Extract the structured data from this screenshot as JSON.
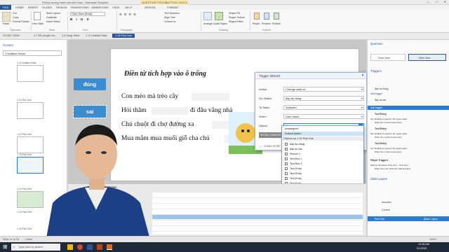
{
  "window": {
    "title": "Phòng tương xanh vào hiệu hợp - Articulate Storyline",
    "context_tab_1": "QUESTION TOOLS",
    "context_tab_2": "BUTTON TOOLS"
  },
  "ribbon_tabs": [
    "FILE",
    "HOME",
    "INSERT",
    "SLIDES",
    "DESIGN",
    "TRANSITIONS",
    "ANIMATIONS",
    "VIEW",
    "HELP"
  ],
  "context_subtabs": [
    "DESIGN",
    "FORMAT"
  ],
  "ribbon": {
    "clipboard": "Clipboard",
    "paste": "Paste",
    "cut": "Cut",
    "copy": "Copy",
    "format_painter": "Format Painter",
    "new_slide": "New Slide",
    "new_layout": "Slide Layout",
    "duplicate": "Duplicate",
    "insert_slides": "Insert Slides",
    "slide_group": "Slide",
    "font_name": "Open Sans (Body)",
    "font_group": "Font",
    "paragraph_group": "Paragraph",
    "text_direction": "Text Direction",
    "align_text": "Align Text",
    "convert": "Convert to",
    "arrange": "Arrange",
    "quick_styles": "Quick Styles",
    "shape_fill": "Shape Fill",
    "shape_outline": "Shape Outline",
    "shape_effect": "Shape Effect",
    "drawing_group": "Drawing",
    "player": "Player",
    "preview": "Preview",
    "publish": "Publish",
    "publish_group": "Publish"
  },
  "doc_tabs": [
    "STORY VIEW",
    "1.7 Hỗ chuyện nh...",
    "1.3 Vùng 'kiếm'",
    "1.11 Untitled Slide",
    "1.15 Pick One"
  ],
  "scenes": {
    "header": "Scenes",
    "scene_select": "1 Untitled Scene",
    "thumbs": [
      "1.10 Untitled Slide",
      "1.11 Pick One",
      "1.12 Pick One",
      "1.13 Pick One",
      "1.14 Pick One",
      "1.15 Pick One",
      "1.16 Pick One"
    ]
  },
  "slide": {
    "title": "Điền từ tích hợp vào ô trống",
    "word_1": "đúng",
    "word_2": "sai",
    "lines": [
      "Con mèo mà trèo cây",
      "Hỏi thăm",
      "đi đâu vắng nhà",
      "Chú chuột đi chợ đường xa",
      "Mua mắm mua muối giỗ cha chú"
    ]
  },
  "timeline": {
    "tab_timeline": "Timeline",
    "tab_states": "States",
    "tab_notes": "Notes"
  },
  "wizard": {
    "title": "Trigger Wizard",
    "fields": [
      {
        "label": "Action:",
        "value": "Change state of"
      },
      {
        "label": "On Object:",
        "value": "đáp án đúng"
      },
      {
        "label": "To State:",
        "value": "Selected"
      },
      {
        "label": "When:",
        "value": "User clicks"
      },
      {
        "label": "Object:",
        "value": "đáp án sai"
      }
    ],
    "show_conditions": "SHOW CONDITIONS",
    "learn_more": "LEARN MORE"
  },
  "dropdown": {
    "items_top": [
      "unassigned",
      "Submit button"
    ],
    "section_1": "Objects on 1.15 Pick One",
    "objects": [
      "đáp án đúng",
      "đáp án sai",
      "Picture 1",
      "Text Box 1",
      "Text Box 2",
      "Text Entry",
      "Text Entry",
      "Text Entry",
      "Text Entry"
    ],
    "section_2": "Create Navigation",
    "nav": [
      "Previous Button",
      "Swipe Previous",
      "Previous Button / Swipe Previous",
      "Next Button",
      "Swipe Next",
      "Next Button / Swipe Next"
    ]
  },
  "right": {
    "question_header": "Question",
    "form_view": "Form View",
    "slide_view": "Slide View",
    "triggers_header": "Triggers",
    "trigger_items": [
      "đáp án đúng",
      "Add trigger",
      "đáp án sai",
      "Add trigger"
    ],
    "text_entry": "Text Entry",
    "text_entry_desc": "Set TextEntry1 equal to the typed value",
    "text_entry_desc2": "When the control loses focus",
    "player_triggers": "Player Triggers",
    "player_desc": "Submit interaction 'Pick One' - 'Pick One'",
    "player_desc2": "When the user clicks the submit button",
    "slide_layers": "Slide Layers",
    "layers": [
      "Incorrect",
      "Correct",
      "Pick One"
    ],
    "base_layer": "(Base Layer)"
  },
  "status": {
    "slide": "Slide 11 of 16",
    "clean": "Clean",
    "zoom": "100%"
  },
  "taskbar": {
    "search": "Type here to search",
    "time": "10:36 AM",
    "date": "2/1/2021"
  },
  "colors": {
    "accent": "#2b579a",
    "word_box": "#3c8cd2",
    "selection": "#2b7ad6"
  }
}
